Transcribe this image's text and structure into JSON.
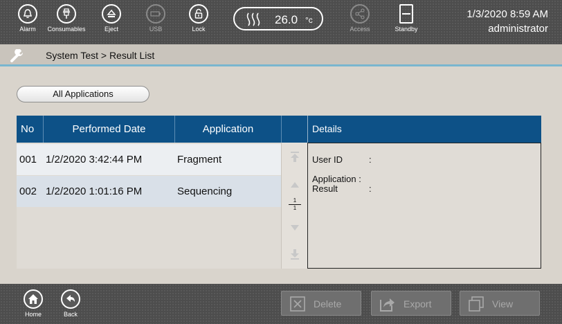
{
  "topbar": {
    "alarm_label": "Alarm",
    "consumables_label": "Consumables",
    "eject_label": "Eject",
    "usb_label": "USB",
    "lock_label": "Lock",
    "temperature_value": "26.0",
    "temperature_unit": "°c",
    "access_label": "Access",
    "standby_label": "Standby",
    "datetime": "1/3/2020 8:59 AM",
    "user": "administrator"
  },
  "breadcrumb": "System Test > Result List",
  "filter": {
    "label": "All Applications"
  },
  "table": {
    "headers": {
      "no": "No",
      "date": "Performed Date",
      "application": "Application"
    },
    "rows": [
      {
        "no": "001",
        "date": "1/2/2020 3:42:44 PM",
        "application": "Fragment"
      },
      {
        "no": "002",
        "date": "1/2/2020 1:01:16 PM",
        "application": "Sequencing"
      }
    ],
    "pager": {
      "current": "1",
      "total": "1"
    }
  },
  "details": {
    "title": "Details",
    "user_id_label": "User ID",
    "user_id_colon": ":",
    "application_label": "Application :",
    "result_label": "Result",
    "result_colon": ":"
  },
  "bottombar": {
    "home_label": "Home",
    "back_label": "Back",
    "delete_label": "Delete",
    "export_label": "Export",
    "view_label": "View"
  }
}
